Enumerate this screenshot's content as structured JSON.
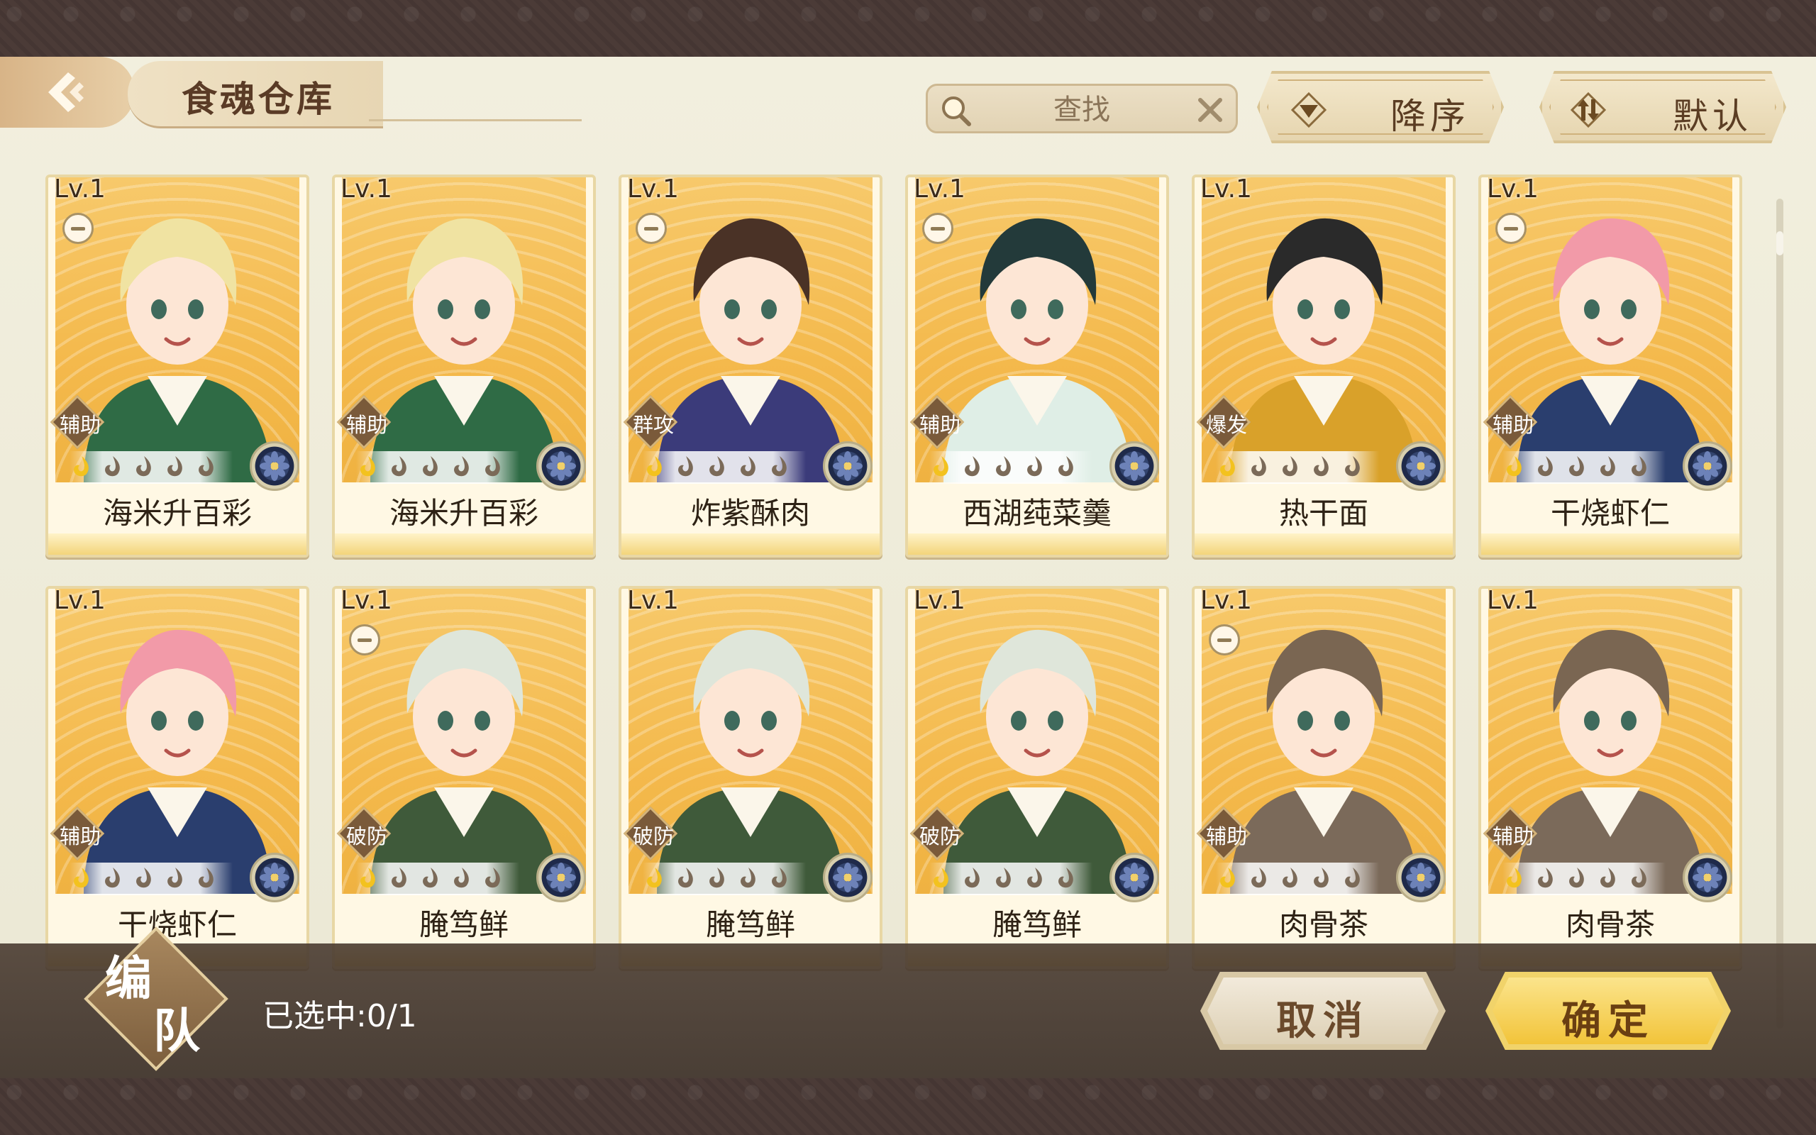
{
  "header": {
    "title": "食魂仓库",
    "search_placeholder": "查找",
    "sort_order_label": "降序",
    "sort_mode_label": "默认"
  },
  "cards": [
    {
      "level": "Lv.1",
      "role": "辅助",
      "name": "海米升百彩",
      "stars": 5,
      "lit": 1,
      "minus": true
    },
    {
      "level": "Lv.1",
      "role": "辅助",
      "name": "海米升百彩",
      "stars": 5,
      "lit": 1,
      "minus": false
    },
    {
      "level": "Lv.1",
      "role": "群攻",
      "name": "炸紫酥肉",
      "stars": 5,
      "lit": 1,
      "minus": true
    },
    {
      "level": "Lv.1",
      "role": "辅助",
      "name": "西湖莼菜羹",
      "stars": 5,
      "lit": 1,
      "minus": true
    },
    {
      "level": "Lv.1",
      "role": "爆发",
      "name": "热干面",
      "stars": 5,
      "lit": 1,
      "minus": false
    },
    {
      "level": "Lv.1",
      "role": "辅助",
      "name": "干烧虾仁",
      "stars": 5,
      "lit": 1,
      "minus": true
    },
    {
      "level": "Lv.1",
      "role": "辅助",
      "name": "干烧虾仁",
      "stars": 5,
      "lit": 1,
      "minus": false
    },
    {
      "level": "Lv.1",
      "role": "破防",
      "name": "腌笃鲜",
      "stars": 5,
      "lit": 1,
      "minus": true
    },
    {
      "level": "Lv.1",
      "role": "破防",
      "name": "腌笃鲜",
      "stars": 5,
      "lit": 1,
      "minus": false
    },
    {
      "level": "Lv.1",
      "role": "破防",
      "name": "腌笃鲜",
      "stars": 5,
      "lit": 1,
      "minus": false
    },
    {
      "level": "Lv.1",
      "role": "辅助",
      "name": "肉骨茶",
      "stars": 5,
      "lit": 1,
      "minus": true
    },
    {
      "level": "Lv.1",
      "role": "辅助",
      "name": "肉骨茶",
      "stars": 5,
      "lit": 1,
      "minus": false
    }
  ],
  "footer": {
    "team_char1": "编",
    "team_char2": "队",
    "selected_text": "已选中:0/1",
    "cancel_label": "取消",
    "confirm_label": "确定"
  },
  "colors": {
    "frame": "#4b3b37",
    "panel": "#f2efde",
    "card_bg": "#f4b94c",
    "confirm": "#f2c43a"
  },
  "icons": {
    "back": "back-arrow-icon",
    "search": "magnifier-icon",
    "clear": "close-icon",
    "sort_order": "triangle-down-icon",
    "sort_mode": "swap-arrows-icon",
    "element": "flower-emblem-icon",
    "star": "flame-star-icon"
  }
}
